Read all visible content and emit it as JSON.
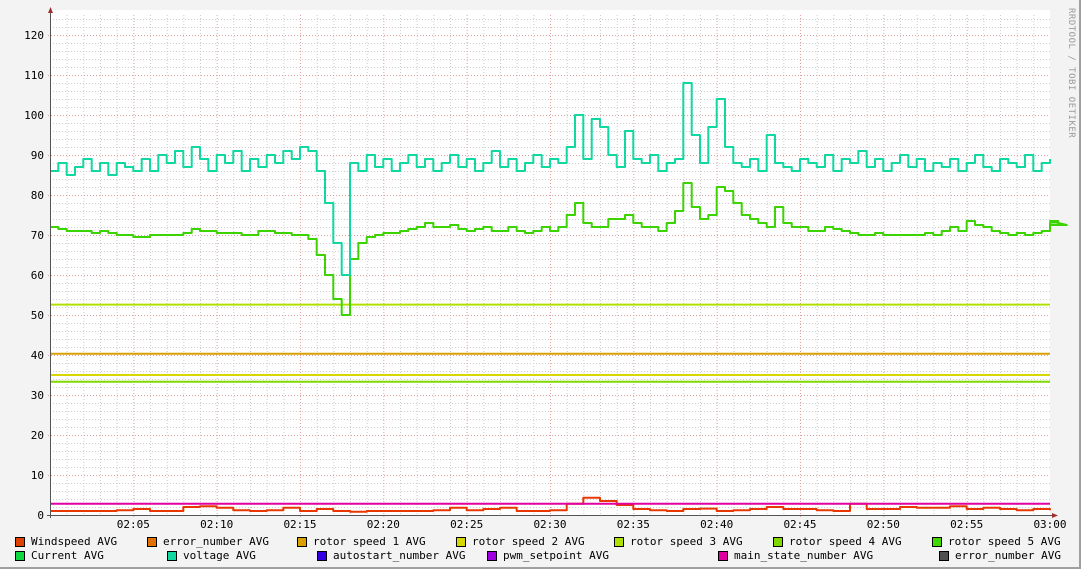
{
  "watermark": "RRDTOOL / TOBI OETIKER",
  "chart_data": {
    "type": "line",
    "title": "",
    "xlabel": "",
    "ylabel": "",
    "ylim": [
      0,
      125
    ],
    "yticks": [
      0,
      10,
      20,
      30,
      40,
      50,
      60,
      70,
      80,
      90,
      100,
      110,
      120
    ],
    "xlim_minutes": [
      0,
      60
    ],
    "xticks": [
      {
        "minute": 5,
        "label": "02:05"
      },
      {
        "minute": 10,
        "label": "02:10"
      },
      {
        "minute": 15,
        "label": "02:15"
      },
      {
        "minute": 20,
        "label": "02:20"
      },
      {
        "minute": 25,
        "label": "02:25"
      },
      {
        "minute": 30,
        "label": "02:30"
      },
      {
        "minute": 35,
        "label": "02:35"
      },
      {
        "minute": 40,
        "label": "02:40"
      },
      {
        "minute": 45,
        "label": "02:45"
      },
      {
        "minute": 50,
        "label": "02:50"
      },
      {
        "minute": 55,
        "label": "02:55"
      },
      {
        "minute": 60,
        "label": "03:00"
      }
    ],
    "grid": true,
    "legend_placement": "bottom",
    "series": [
      {
        "name": "Windspeed AVG",
        "color": "#e04000",
        "line_color": "#e83800",
        "step_minutes": 1,
        "values": [
          1,
          1,
          1,
          1,
          1.2,
          1.5,
          1,
          1,
          2,
          2.2,
          1.8,
          1.2,
          1,
          1.2,
          1.8,
          1,
          1.5,
          1,
          0.8,
          1,
          1,
          1,
          1,
          1.2,
          1.8,
          1.2,
          1.5,
          1.8,
          1,
          1,
          1.2,
          2.8,
          4.3,
          3.5,
          2.5,
          1.5,
          1.2,
          1,
          1.5,
          1.6,
          1,
          1.2,
          1.5,
          2,
          1.5,
          1.5,
          1.2,
          1,
          2.8,
          1.5,
          1.5,
          2,
          1.8,
          1.8,
          2.2,
          1.5,
          1.8,
          1.5,
          1.2,
          1.5,
          1.2
        ]
      },
      {
        "name": "error_number AVG",
        "color": "#e07000",
        "values": []
      },
      {
        "name": "rotor speed 1 AVG",
        "color": "#d8a000",
        "constant": 40.3
      },
      {
        "name": "rotor speed 2 AVG",
        "color": "#d8d800",
        "constant": 35
      },
      {
        "name": "rotor speed 3 AVG",
        "color": "#b0e000",
        "constant": 52.6
      },
      {
        "name": "rotor speed 4 AVG",
        "color": "#80d800",
        "constant": 33.3
      },
      {
        "name": "rotor speed 5 AVG",
        "color": "#40d800",
        "values": []
      },
      {
        "name": "Current AVG",
        "color": "#10d840",
        "line_color": "#3cd400",
        "step_minutes": 0.5,
        "values": [
          72,
          71.5,
          71,
          71,
          71,
          70.5,
          71,
          70.5,
          70,
          70,
          69.5,
          69.5,
          70,
          70,
          70,
          70,
          70.5,
          71.5,
          71,
          71,
          70.5,
          70.5,
          70.5,
          70,
          70,
          71,
          71,
          70.5,
          70.5,
          70,
          70,
          69,
          65,
          60,
          54,
          50,
          64,
          68,
          69.5,
          70,
          70.5,
          70.5,
          71,
          71.5,
          72,
          73,
          72,
          72,
          72.5,
          71.5,
          71,
          71.5,
          72,
          71,
          71,
          72,
          71,
          70.5,
          71,
          72,
          71,
          72,
          75,
          78,
          73,
          72,
          72,
          74,
          74,
          75,
          73,
          72,
          72,
          71,
          73,
          76,
          83,
          77,
          74,
          75,
          82,
          81,
          78,
          75,
          74,
          73,
          72,
          77,
          73,
          72,
          72,
          71,
          71,
          72,
          71.5,
          71,
          70.5,
          70,
          70,
          70.5,
          70,
          70,
          70,
          70,
          70,
          70.5,
          70,
          71,
          72,
          71,
          73.5,
          72.5,
          72,
          71,
          70.5,
          70,
          70.5,
          70,
          70.5,
          71,
          73,
          73.5,
          72.5
        ]
      },
      {
        "name": "voltage AVG",
        "color": "#10d8a0",
        "line_color": "#10d8a0",
        "step_minutes": 0.5,
        "values": [
          86,
          88,
          85,
          87,
          89,
          86,
          88,
          85,
          88,
          87,
          86,
          89,
          86,
          90,
          88,
          91,
          87,
          92,
          89,
          86,
          90,
          88,
          91,
          86,
          89,
          87,
          90,
          88,
          91,
          89,
          92,
          91,
          86,
          78,
          68,
          60,
          88,
          86,
          90,
          87,
          89,
          86,
          88,
          90,
          87,
          89,
          86,
          88,
          90,
          87,
          89,
          86,
          88,
          91,
          87,
          89,
          86,
          88,
          90,
          87,
          89,
          88,
          92,
          100,
          89,
          99,
          97,
          90,
          87,
          96,
          89,
          88,
          90,
          86,
          88,
          89,
          108,
          95,
          88,
          97,
          104,
          92,
          88,
          87,
          89,
          86,
          95,
          88,
          87,
          86,
          89,
          88,
          87,
          90,
          86,
          89,
          88,
          91,
          87,
          89,
          86,
          88,
          90,
          87,
          89,
          86,
          88,
          87,
          89,
          86,
          88,
          90,
          87,
          86,
          89,
          88,
          87,
          90,
          86,
          88,
          89
        ]
      },
      {
        "name": "autostart_number AVG",
        "color": "#3000e0",
        "values": []
      },
      {
        "name": "pwm_setpoint AVG",
        "color": "#a000e0",
        "values": []
      },
      {
        "name": "main_state_number AVG",
        "color": "#e000a0",
        "constant": 2.8
      },
      {
        "name": "error_number AVG",
        "color": "#505050",
        "values": []
      }
    ]
  }
}
